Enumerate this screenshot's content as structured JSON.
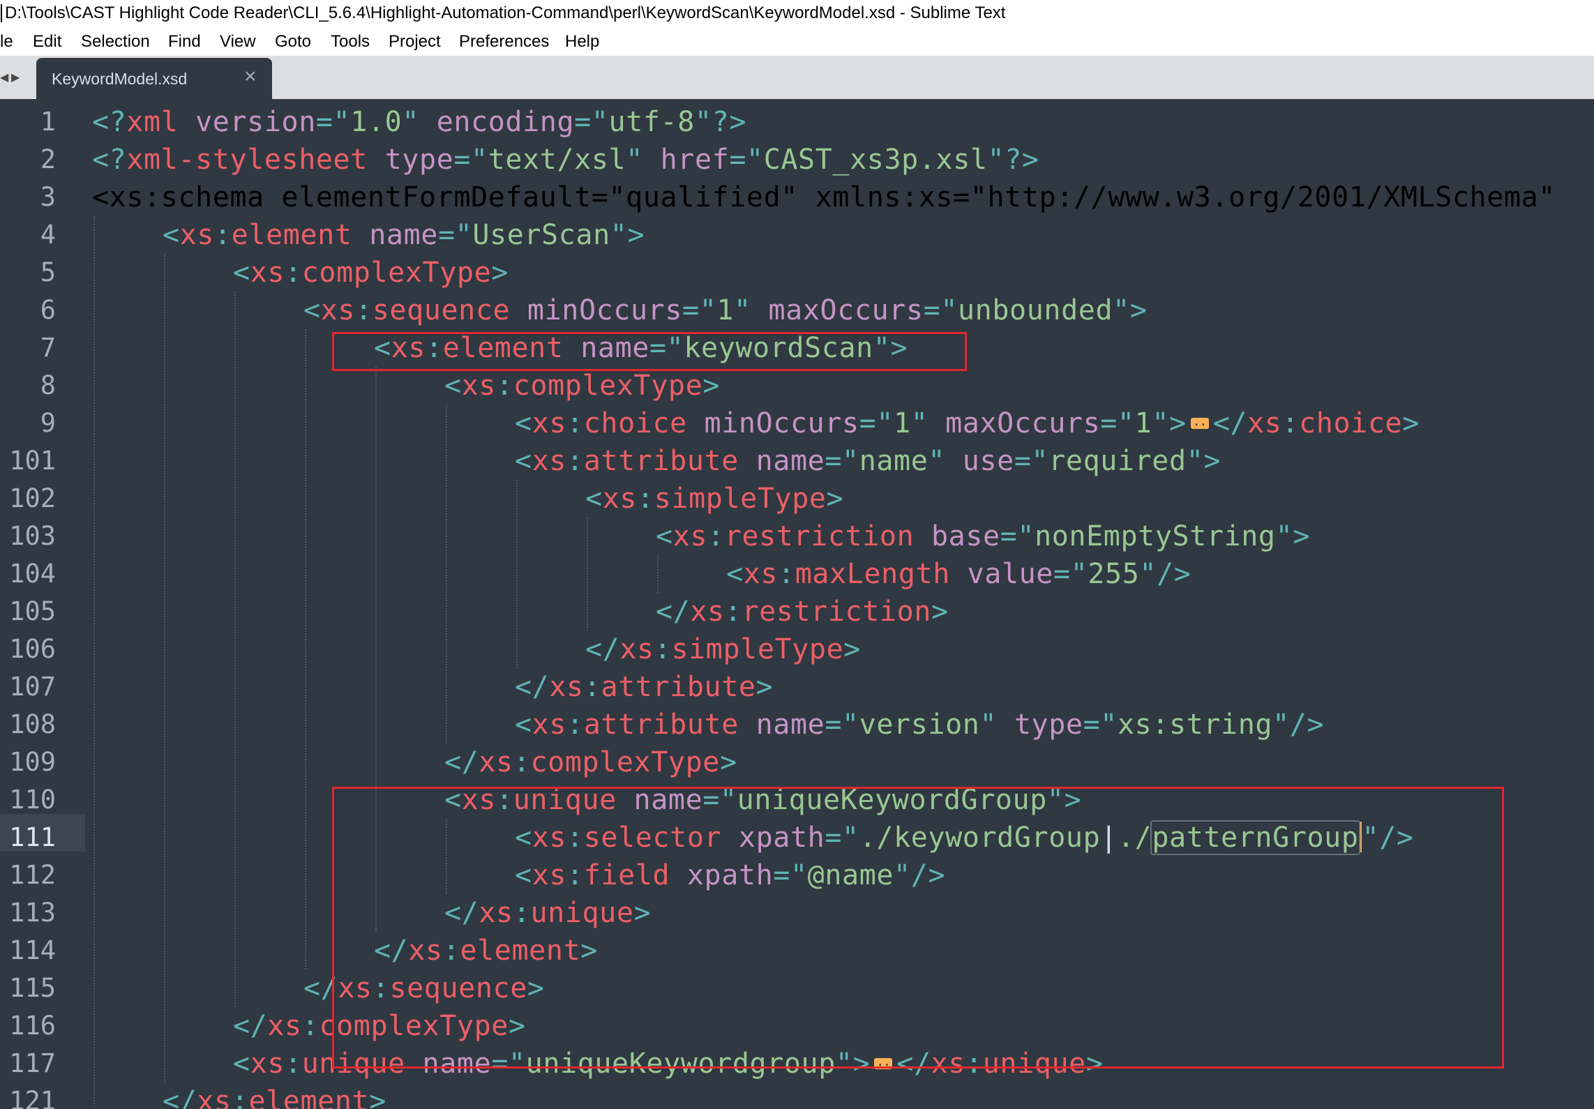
{
  "window": {
    "title": "D:\\Tools\\CAST Highlight Code Reader\\CLI_5.6.4\\Highlight-Automation-Command\\perl\\KeywordScan\\KeywordModel.xsd - Sublime Text"
  },
  "menu": {
    "items": [
      "le",
      "Edit",
      "Selection",
      "Find",
      "View",
      "Goto",
      "Tools",
      "Project",
      "Preferences",
      "Help"
    ]
  },
  "tabs": [
    {
      "label": "KeywordModel.xsd",
      "close": "×"
    }
  ],
  "editor": {
    "current_line": "111",
    "highlighted_word": "patternGroup",
    "lines": [
      {
        "num": "1",
        "text": "<?xml version=\"1.0\" encoding=\"utf-8\"?>"
      },
      {
        "num": "2",
        "text": "<?xml-stylesheet type=\"text/xsl\" href=\"CAST_xs3p.xsl\"?>"
      },
      {
        "num": "3",
        "text": "<xs:schema elementFormDefault=\"qualified\" xmlns:xs=\"http://www.w3.org/2001/XMLSchema\""
      },
      {
        "num": "4",
        "text": "<xs:element name=\"UserScan\">"
      },
      {
        "num": "5",
        "text": "<xs:complexType>"
      },
      {
        "num": "6",
        "text": "<xs:sequence minOccurs=\"1\" maxOccurs=\"unbounded\">"
      },
      {
        "num": "7",
        "text": "<xs:element name=\"keywordScan\">"
      },
      {
        "num": "8",
        "text": "<xs:complexType>"
      },
      {
        "num": "9",
        "text": "<xs:choice minOccurs=\"1\" maxOccurs=\"1\">…</xs:choice>"
      },
      {
        "num": "101",
        "text": "<xs:attribute name=\"name\" use=\"required\">"
      },
      {
        "num": "102",
        "text": "<xs:simpleType>"
      },
      {
        "num": "103",
        "text": "<xs:restriction base=\"nonEmptyString\">"
      },
      {
        "num": "104",
        "text": "<xs:maxLength value=\"255\"/>"
      },
      {
        "num": "105",
        "text": "</xs:restriction>"
      },
      {
        "num": "106",
        "text": "</xs:simpleType>"
      },
      {
        "num": "107",
        "text": "</xs:attribute>"
      },
      {
        "num": "108",
        "text": "<xs:attribute name=\"version\" type=\"xs:string\"/>"
      },
      {
        "num": "109",
        "text": "</xs:complexType>"
      },
      {
        "num": "110",
        "text": "<xs:unique name=\"uniqueKeywordGroup\">"
      },
      {
        "num": "111",
        "text": "<xs:selector xpath=\"./keywordGroup|./patternGroup\"/>"
      },
      {
        "num": "112",
        "text": "<xs:field xpath=\"@name\"/>"
      },
      {
        "num": "113",
        "text": "</xs:unique>"
      },
      {
        "num": "114",
        "text": "</xs:element>"
      },
      {
        "num": "115",
        "text": "</xs:sequence>"
      },
      {
        "num": "116",
        "text": "</xs:complexType>"
      },
      {
        "num": "117",
        "text": "<xs:unique name=\"uniqueKeywordgroup\">…</xs:unique>"
      },
      {
        "num": "121",
        "text": "</xs:element>"
      }
    ]
  },
  "colors": {
    "background": "#303841",
    "punctuation": "#5fb4b4",
    "tag": "#ec5f67",
    "attribute": "#c594c5",
    "string": "#99c794",
    "annotation_box": "#e2282e"
  }
}
